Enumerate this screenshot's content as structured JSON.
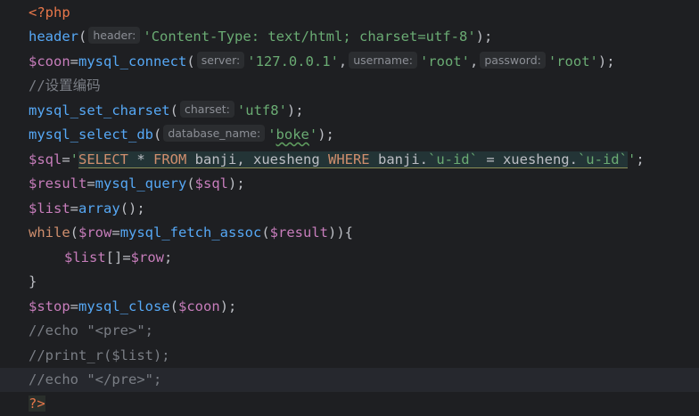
{
  "code": {
    "l1": {
      "open_tag": "<?php"
    },
    "l2": {
      "fn": "header",
      "paren_open": "(",
      "hint": "header:",
      "arg": "'Content-Type: text/html; charset=utf-8'",
      "close": ");"
    },
    "l3": {
      "var": "$coon",
      "eq": "=",
      "fn": "mysql_connect",
      "paren_open": "(",
      "hint1": "server:",
      "arg1": "'127.0.0.1'",
      "comma1": ",",
      "hint2": "username:",
      "arg2": "'root'",
      "comma2": ",",
      "hint3": "password:",
      "arg3": "'root'",
      "close": ");"
    },
    "l4": {
      "comment": "//设置编码"
    },
    "l5": {
      "fn": "mysql_set_charset",
      "paren_open": "(",
      "hint": "charset:",
      "arg": "'utf8'",
      "close": ");"
    },
    "l6": {
      "fn": "mysql_select_db",
      "paren_open": "(",
      "hint": "database_name:",
      "q1": "'",
      "arg": "boke",
      "q2": "'",
      "close": ");"
    },
    "l7": {
      "var": "$sql",
      "eq": "=",
      "q1": "'",
      "select": "SELECT",
      "star": " * ",
      "from": "FROM",
      "t1": " banji, xuesheng ",
      "where": "WHERE",
      "t2": " banji.",
      "col1": "`u-id`",
      "t3": " = xuesheng.",
      "col2": "`u-id`",
      "q2": "'",
      "semi": ";"
    },
    "l8": {
      "var": "$result",
      "eq": "=",
      "fn": "mysql_query",
      "paren_open": "(",
      "arg": "$sql",
      "close": ");"
    },
    "l9": {
      "var": "$list",
      "eq": "=",
      "fn": "array",
      "close": "();"
    },
    "l10": {
      "kw": "while",
      "p1": "(",
      "var1": "$row",
      "eq": "=",
      "fn": "mysql_fetch_assoc",
      "p2": "(",
      "var2": "$result",
      "close": ")){"
    },
    "l11": {
      "var1": "$list",
      "mid": "[]=",
      "var2": "$row",
      "semi": ";"
    },
    "l12": {
      "brace": "}"
    },
    "l13": {
      "var1": "$stop",
      "eq": "=",
      "fn": "mysql_close",
      "p": "(",
      "var2": "$coon",
      "close": ");"
    },
    "l14": {
      "comment": "//echo \"<pre>\";"
    },
    "l15": {
      "comment": "//print_r($list);"
    },
    "l16": {
      "comment": "//echo \"</pre>\";"
    },
    "l17": {
      "close_tag": "?>"
    }
  }
}
